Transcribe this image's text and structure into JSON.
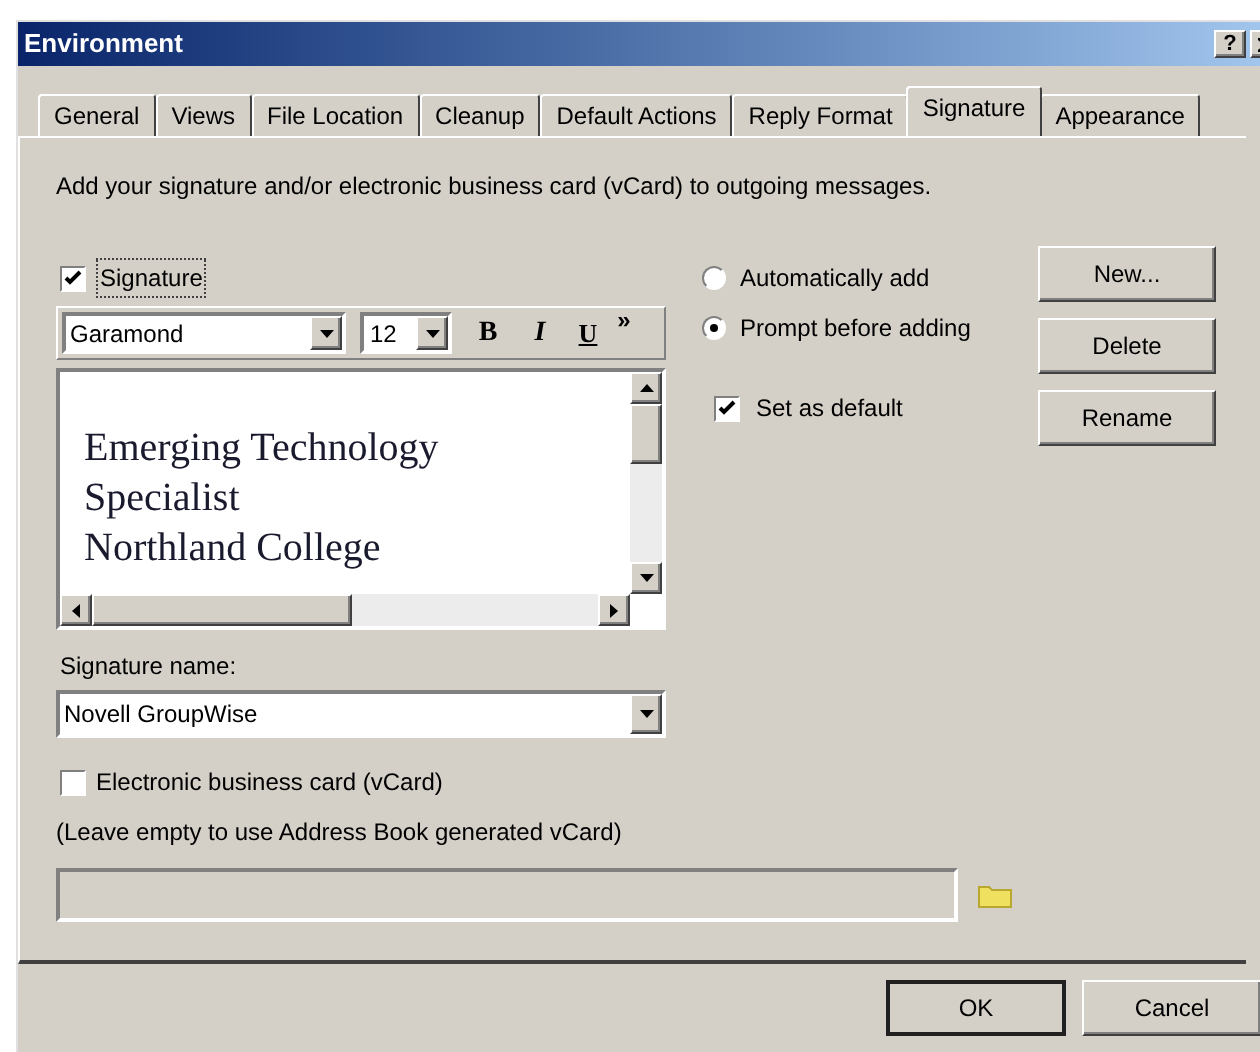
{
  "window": {
    "title": "Environment",
    "help": "?"
  },
  "tabs": [
    {
      "label": "General",
      "selected": false
    },
    {
      "label": "Views",
      "selected": false
    },
    {
      "label": "File Location",
      "selected": false
    },
    {
      "label": "Cleanup",
      "selected": false
    },
    {
      "label": "Default Actions",
      "selected": false
    },
    {
      "label": "Reply Format",
      "selected": false
    },
    {
      "label": "Signature",
      "selected": true
    },
    {
      "label": "Appearance",
      "selected": false
    }
  ],
  "description": "Add your signature and/or electronic business card (vCard) to outgoing messages.",
  "signature_checkbox": {
    "label": "Signature",
    "checked": true
  },
  "toolbar": {
    "font": "Garamond",
    "size": "12",
    "bold": "B",
    "italic": "I",
    "underline": "U",
    "more": "»"
  },
  "editor": {
    "lines": [
      "Emerging Technology",
      "Specialist",
      "Northland College"
    ]
  },
  "radios": [
    {
      "label": "Automatically add",
      "selected": false
    },
    {
      "label": "Prompt before adding",
      "selected": true
    }
  ],
  "set_default": {
    "label": "Set as default",
    "checked": true
  },
  "side_buttons": [
    "New...",
    "Delete",
    "Rename"
  ],
  "signature_name": {
    "label": "Signature name:",
    "value": "Novell GroupWise"
  },
  "vcard": {
    "label": "Electronic business card (vCard)",
    "checked": false,
    "hint": "(Leave empty to use Address Book generated vCard)",
    "disabled": true
  },
  "buttons": [
    "OK",
    "Cancel"
  ]
}
